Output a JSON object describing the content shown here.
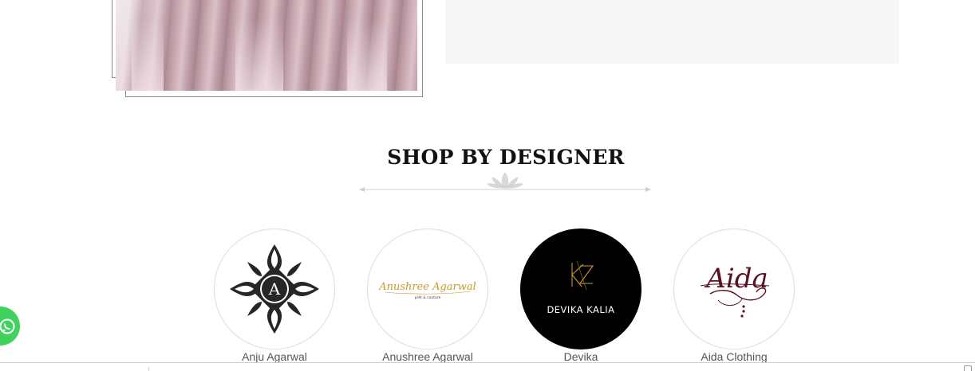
{
  "section": {
    "title": "SHOP BY DESIGNER"
  },
  "designers": [
    {
      "name": "Anju Agarwal",
      "logo_text": "A"
    },
    {
      "name": "Anushree Agarwal",
      "logo_text": "Anushree Agarwal",
      "logo_subtext": "prêt & couture"
    },
    {
      "name": "Devika",
      "logo_text": "DEVIKA KALIA",
      "logo_monogram": "DK"
    },
    {
      "name": "Aida Clothing",
      "logo_text": "Aida"
    }
  ],
  "floating": {
    "icon": "whatsapp-icon",
    "color": "#3fd35e"
  },
  "colors": {
    "panel": "#f6f6f6",
    "accent_gold": "#c99a2e",
    "aida_maroon": "#5a1020"
  }
}
